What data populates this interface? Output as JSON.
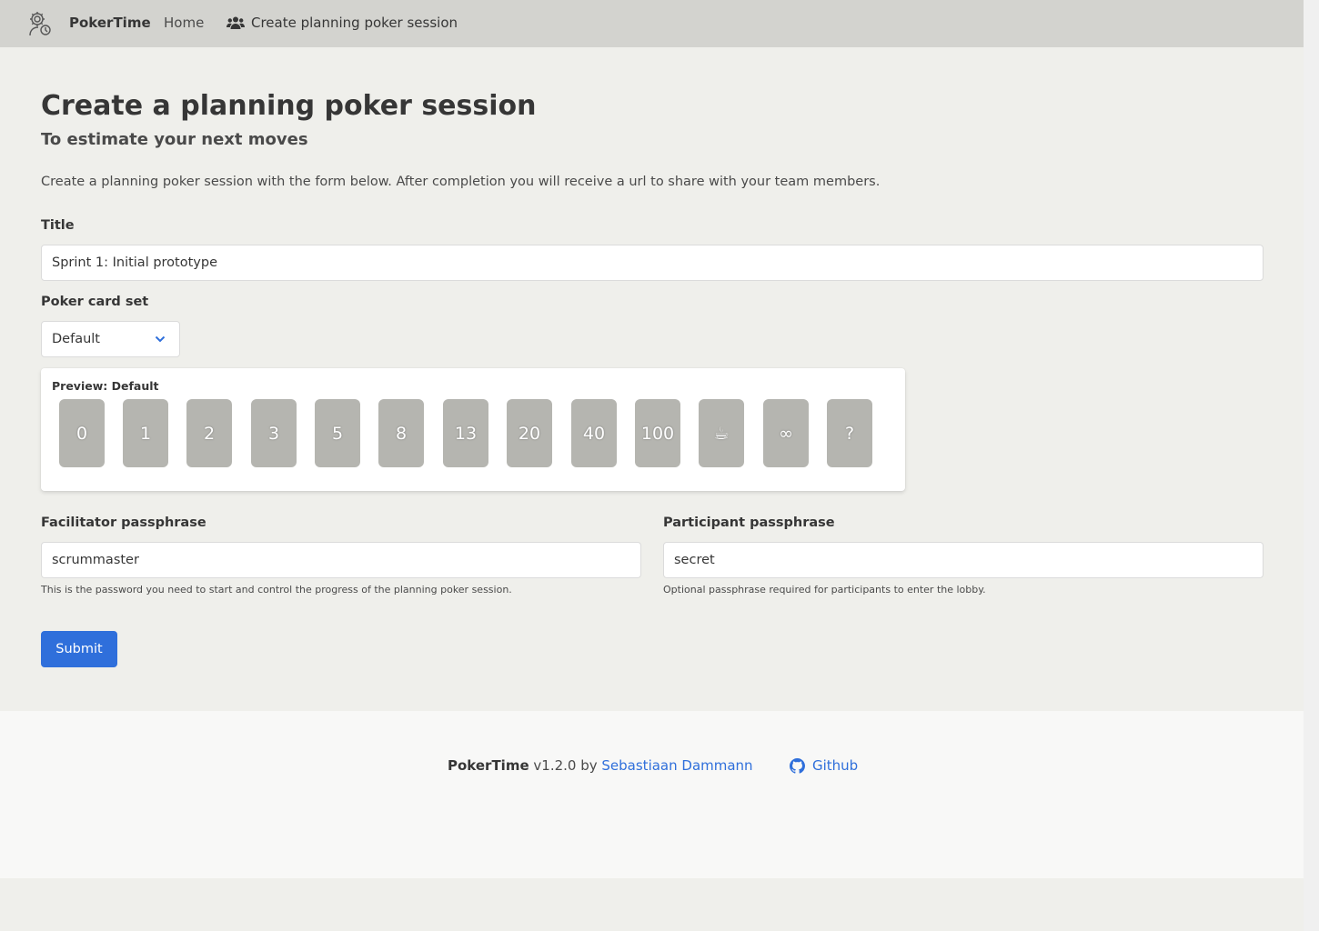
{
  "navbar": {
    "brand": "PokerTime",
    "home": "Home",
    "create": "Create planning poker session"
  },
  "page": {
    "title": "Create a planning poker session",
    "subtitle": "To estimate your next moves",
    "intro": "Create a planning poker session with the form below. After completion you will receive a url to share with your team members."
  },
  "form": {
    "title_label": "Title",
    "title_value": "Sprint 1: Initial prototype",
    "cardset_label": "Poker card set",
    "cardset_value": "Default",
    "preview_label": "Preview: Default",
    "cards": [
      "0",
      "1",
      "2",
      "3",
      "5",
      "8",
      "13",
      "20",
      "40",
      "100",
      "☕",
      "∞",
      "?"
    ],
    "facilitator_label": "Facilitator passphrase",
    "facilitator_value": "scrummaster",
    "facilitator_help": "This is the password you need to start and control the progress of the planning poker session.",
    "participant_label": "Participant passphrase",
    "participant_value": "secret",
    "participant_help": "Optional passphrase required for participants to enter the lobby.",
    "submit_label": "Submit"
  },
  "footer": {
    "brand": "PokerTime",
    "version": "v1.2.0 by",
    "author": "Sebastiaan Dammann",
    "github": "Github"
  },
  "colors": {
    "accent": "#2f6fdb",
    "navbar_bg": "#d3d3cf",
    "card_bg": "#b5b5b0"
  }
}
